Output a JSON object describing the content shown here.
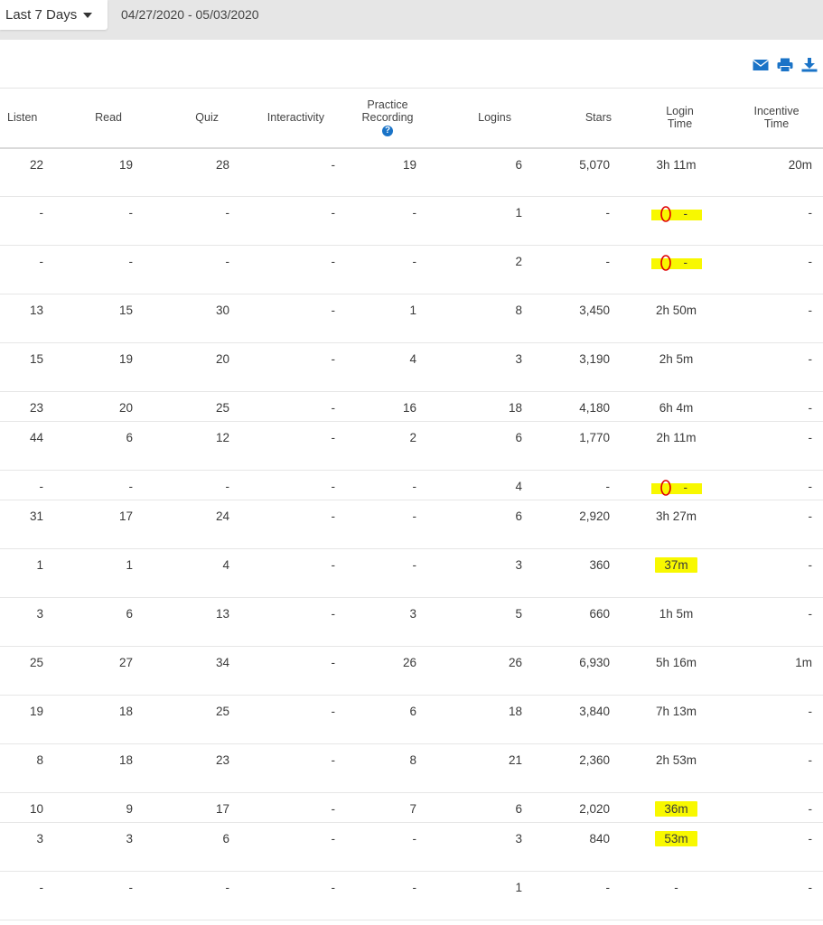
{
  "filter": {
    "range_label": "Last 7 Days",
    "date_range": "04/27/2020 - 05/03/2020"
  },
  "toolbar": {
    "icons": [
      "email-icon",
      "print-icon",
      "download-icon"
    ],
    "accent_color": "#1a73c7"
  },
  "table": {
    "headers": {
      "listen": "Listen",
      "read": "Read",
      "quiz": "Quiz",
      "interactivity": "Interactivity",
      "practice_line1": "Practice",
      "practice_line2": "Recording",
      "help_glyph": "?",
      "logins": "Logins",
      "stars": "Stars",
      "login_line1": "Login",
      "login_line2": "Time",
      "incentive_line1": "Incentive",
      "incentive_line2": "Time"
    },
    "highlight_color": "#f8f800",
    "annotation_color": "#e00000",
    "rows": [
      {
        "cells": [
          "22",
          "19",
          "28",
          "-",
          "19",
          "6",
          "5,070",
          "3h 11m",
          "20m"
        ],
        "tall": true,
        "mark": "none"
      },
      {
        "cells": [
          "-",
          "-",
          "-",
          "-",
          "-",
          "1",
          "-",
          "-",
          "-"
        ],
        "tall": true,
        "mark": "circled-zero"
      },
      {
        "cells": [
          "-",
          "-",
          "-",
          "-",
          "-",
          "2",
          "-",
          "-",
          "-"
        ],
        "tall": true,
        "mark": "circled-zero"
      },
      {
        "cells": [
          "13",
          "15",
          "30",
          "-",
          "1",
          "8",
          "3,450",
          "2h 50m",
          "-"
        ],
        "tall": true,
        "mark": "none"
      },
      {
        "cells": [
          "15",
          "19",
          "20",
          "-",
          "4",
          "3",
          "3,190",
          "2h 5m",
          "-"
        ],
        "tall": true,
        "mark": "none"
      },
      {
        "cells": [
          "23",
          "20",
          "25",
          "-",
          "16",
          "18",
          "4,180",
          "6h 4m",
          "-"
        ],
        "tall": false,
        "mark": "none"
      },
      {
        "cells": [
          "44",
          "6",
          "12",
          "-",
          "2",
          "6",
          "1,770",
          "2h 11m",
          "-"
        ],
        "tall": true,
        "mark": "none"
      },
      {
        "cells": [
          "-",
          "-",
          "-",
          "-",
          "-",
          "4",
          "-",
          "-",
          "-"
        ],
        "tall": false,
        "mark": "circled-zero"
      },
      {
        "cells": [
          "31",
          "17",
          "24",
          "-",
          "-",
          "6",
          "2,920",
          "3h 27m",
          "-"
        ],
        "tall": true,
        "mark": "none"
      },
      {
        "cells": [
          "1",
          "1",
          "4",
          "-",
          "-",
          "3",
          "360",
          "37m",
          "-"
        ],
        "tall": true,
        "mark": "highlight"
      },
      {
        "cells": [
          "3",
          "6",
          "13",
          "-",
          "3",
          "5",
          "660",
          "1h 5m",
          "-"
        ],
        "tall": true,
        "mark": "none"
      },
      {
        "cells": [
          "25",
          "27",
          "34",
          "-",
          "26",
          "26",
          "6,930",
          "5h 16m",
          "1m"
        ],
        "tall": true,
        "mark": "none"
      },
      {
        "cells": [
          "19",
          "18",
          "25",
          "-",
          "6",
          "18",
          "3,840",
          "7h 13m",
          "-"
        ],
        "tall": true,
        "mark": "none"
      },
      {
        "cells": [
          "8",
          "18",
          "23",
          "-",
          "8",
          "21",
          "2,360",
          "2h 53m",
          "-"
        ],
        "tall": true,
        "mark": "none"
      },
      {
        "cells": [
          "10",
          "9",
          "17",
          "-",
          "7",
          "6",
          "2,020",
          "36m",
          "-"
        ],
        "tall": false,
        "mark": "highlight"
      },
      {
        "cells": [
          "3",
          "3",
          "6",
          "-",
          "-",
          "3",
          "840",
          "53m",
          "-"
        ],
        "tall": true,
        "mark": "highlight"
      },
      {
        "cells": [
          "-",
          "-",
          "-",
          "-",
          "-",
          "1",
          "-",
          "-",
          "-"
        ],
        "tall": true,
        "mark": "none"
      }
    ]
  }
}
